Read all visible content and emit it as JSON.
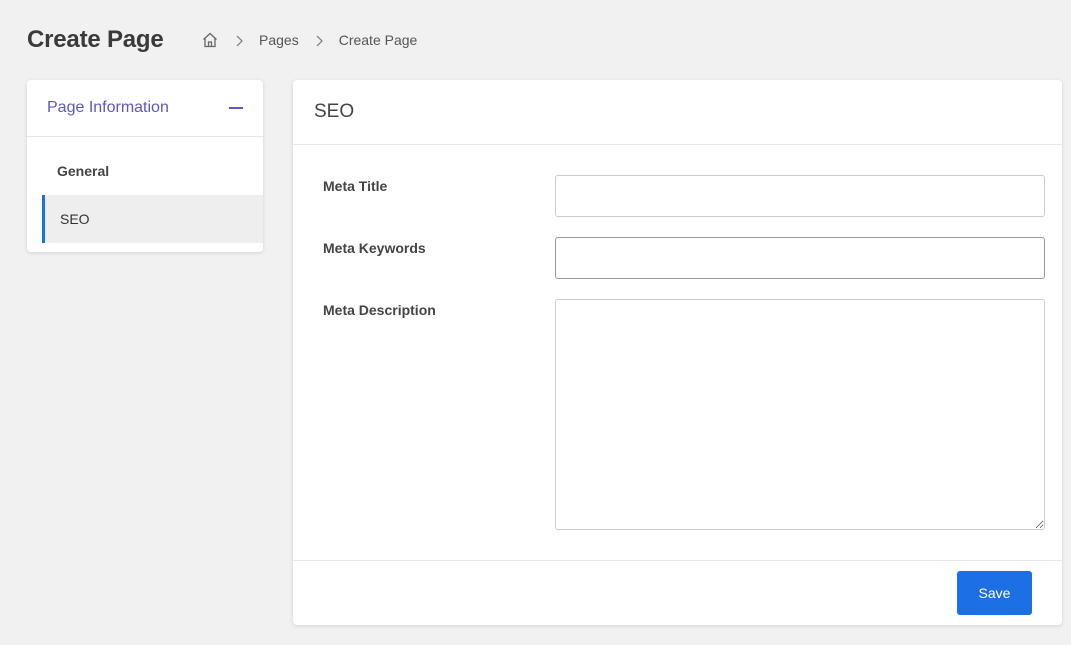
{
  "header": {
    "title": "Create Page"
  },
  "breadcrumb": {
    "home_icon": "home-icon",
    "separator_icon": "chevron-right-icon",
    "items": [
      "Pages",
      "Create Page"
    ]
  },
  "sidebar": {
    "title": "Page Information",
    "collapse_icon": "minus-icon",
    "items": [
      {
        "label": "General",
        "active": false
      },
      {
        "label": "SEO",
        "active": true
      }
    ]
  },
  "main": {
    "section_title": "SEO",
    "fields": {
      "meta_title": {
        "label": "Meta Title",
        "value": ""
      },
      "meta_keywords": {
        "label": "Meta Keywords",
        "value": ""
      },
      "meta_description": {
        "label": "Meta Description",
        "value": ""
      }
    },
    "save_label": "Save"
  },
  "colors": {
    "accent": "#5b57c9",
    "primary": "#1d6fe6",
    "background": "#f1f1f1"
  }
}
